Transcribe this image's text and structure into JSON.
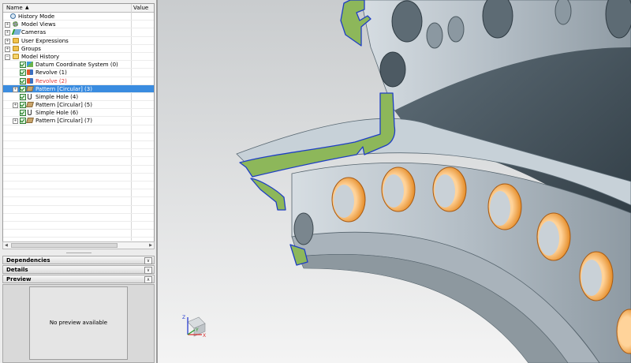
{
  "navigator": {
    "columns": {
      "name": "Name",
      "sort_arrow": "▲",
      "value": "Value"
    },
    "rows": [
      {
        "label": "History Mode",
        "icon": "history-mode-icon"
      },
      {
        "label": "Model Views",
        "icon": "model-views-icon",
        "expand": "+"
      },
      {
        "label": "Cameras",
        "icon": "cameras-icon",
        "expand": "+"
      },
      {
        "label": "User Expressions",
        "icon": "folder-icon",
        "expand": "+"
      },
      {
        "label": "Groups",
        "icon": "folder-icon",
        "expand": "+"
      },
      {
        "label": "Model History",
        "icon": "folder-open-icon",
        "expand": "−"
      },
      {
        "label": "Datum Coordinate System (0)",
        "icon": "datum-csys-icon"
      },
      {
        "label": "Revolve (1)",
        "icon": "revolve-icon"
      },
      {
        "label": "Revolve (2)",
        "icon": "revolve-icon",
        "status": "warning"
      },
      {
        "label": "Pattern [Circular] (3)",
        "icon": "pattern-icon",
        "expand": "+",
        "selected": true
      },
      {
        "label": "Simple Hole (4)",
        "icon": "simple-hole-icon"
      },
      {
        "label": "Pattern [Circular] (5)",
        "icon": "pattern-icon",
        "expand": "+"
      },
      {
        "label": "Simple Hole (6)",
        "icon": "simple-hole-icon"
      },
      {
        "label": "Pattern [Circular] (7)",
        "icon": "pattern-icon",
        "expand": "+"
      }
    ],
    "panels": {
      "dependencies": "Dependencies",
      "details": "Details",
      "preview": "Preview",
      "preview_message": "No preview available"
    },
    "scroll_arrow_left": "◀",
    "scroll_arrow_right": "▶",
    "panel_collapse_glyph": "∨",
    "panel_expand_glyph": "∧"
  },
  "triad": {
    "x_label": "X",
    "y_label": "Y",
    "z_label": "Z"
  },
  "colors": {
    "selection": "#3a8ce0",
    "warning_text": "#e03c3c",
    "section_fill": "#8db75a",
    "section_edge": "#1f3fc4",
    "hole_rim": "#f0a040",
    "part_surface": "#b7c2cb",
    "background_top": "#c9ccce",
    "background_bottom": "#f4f4f4"
  }
}
